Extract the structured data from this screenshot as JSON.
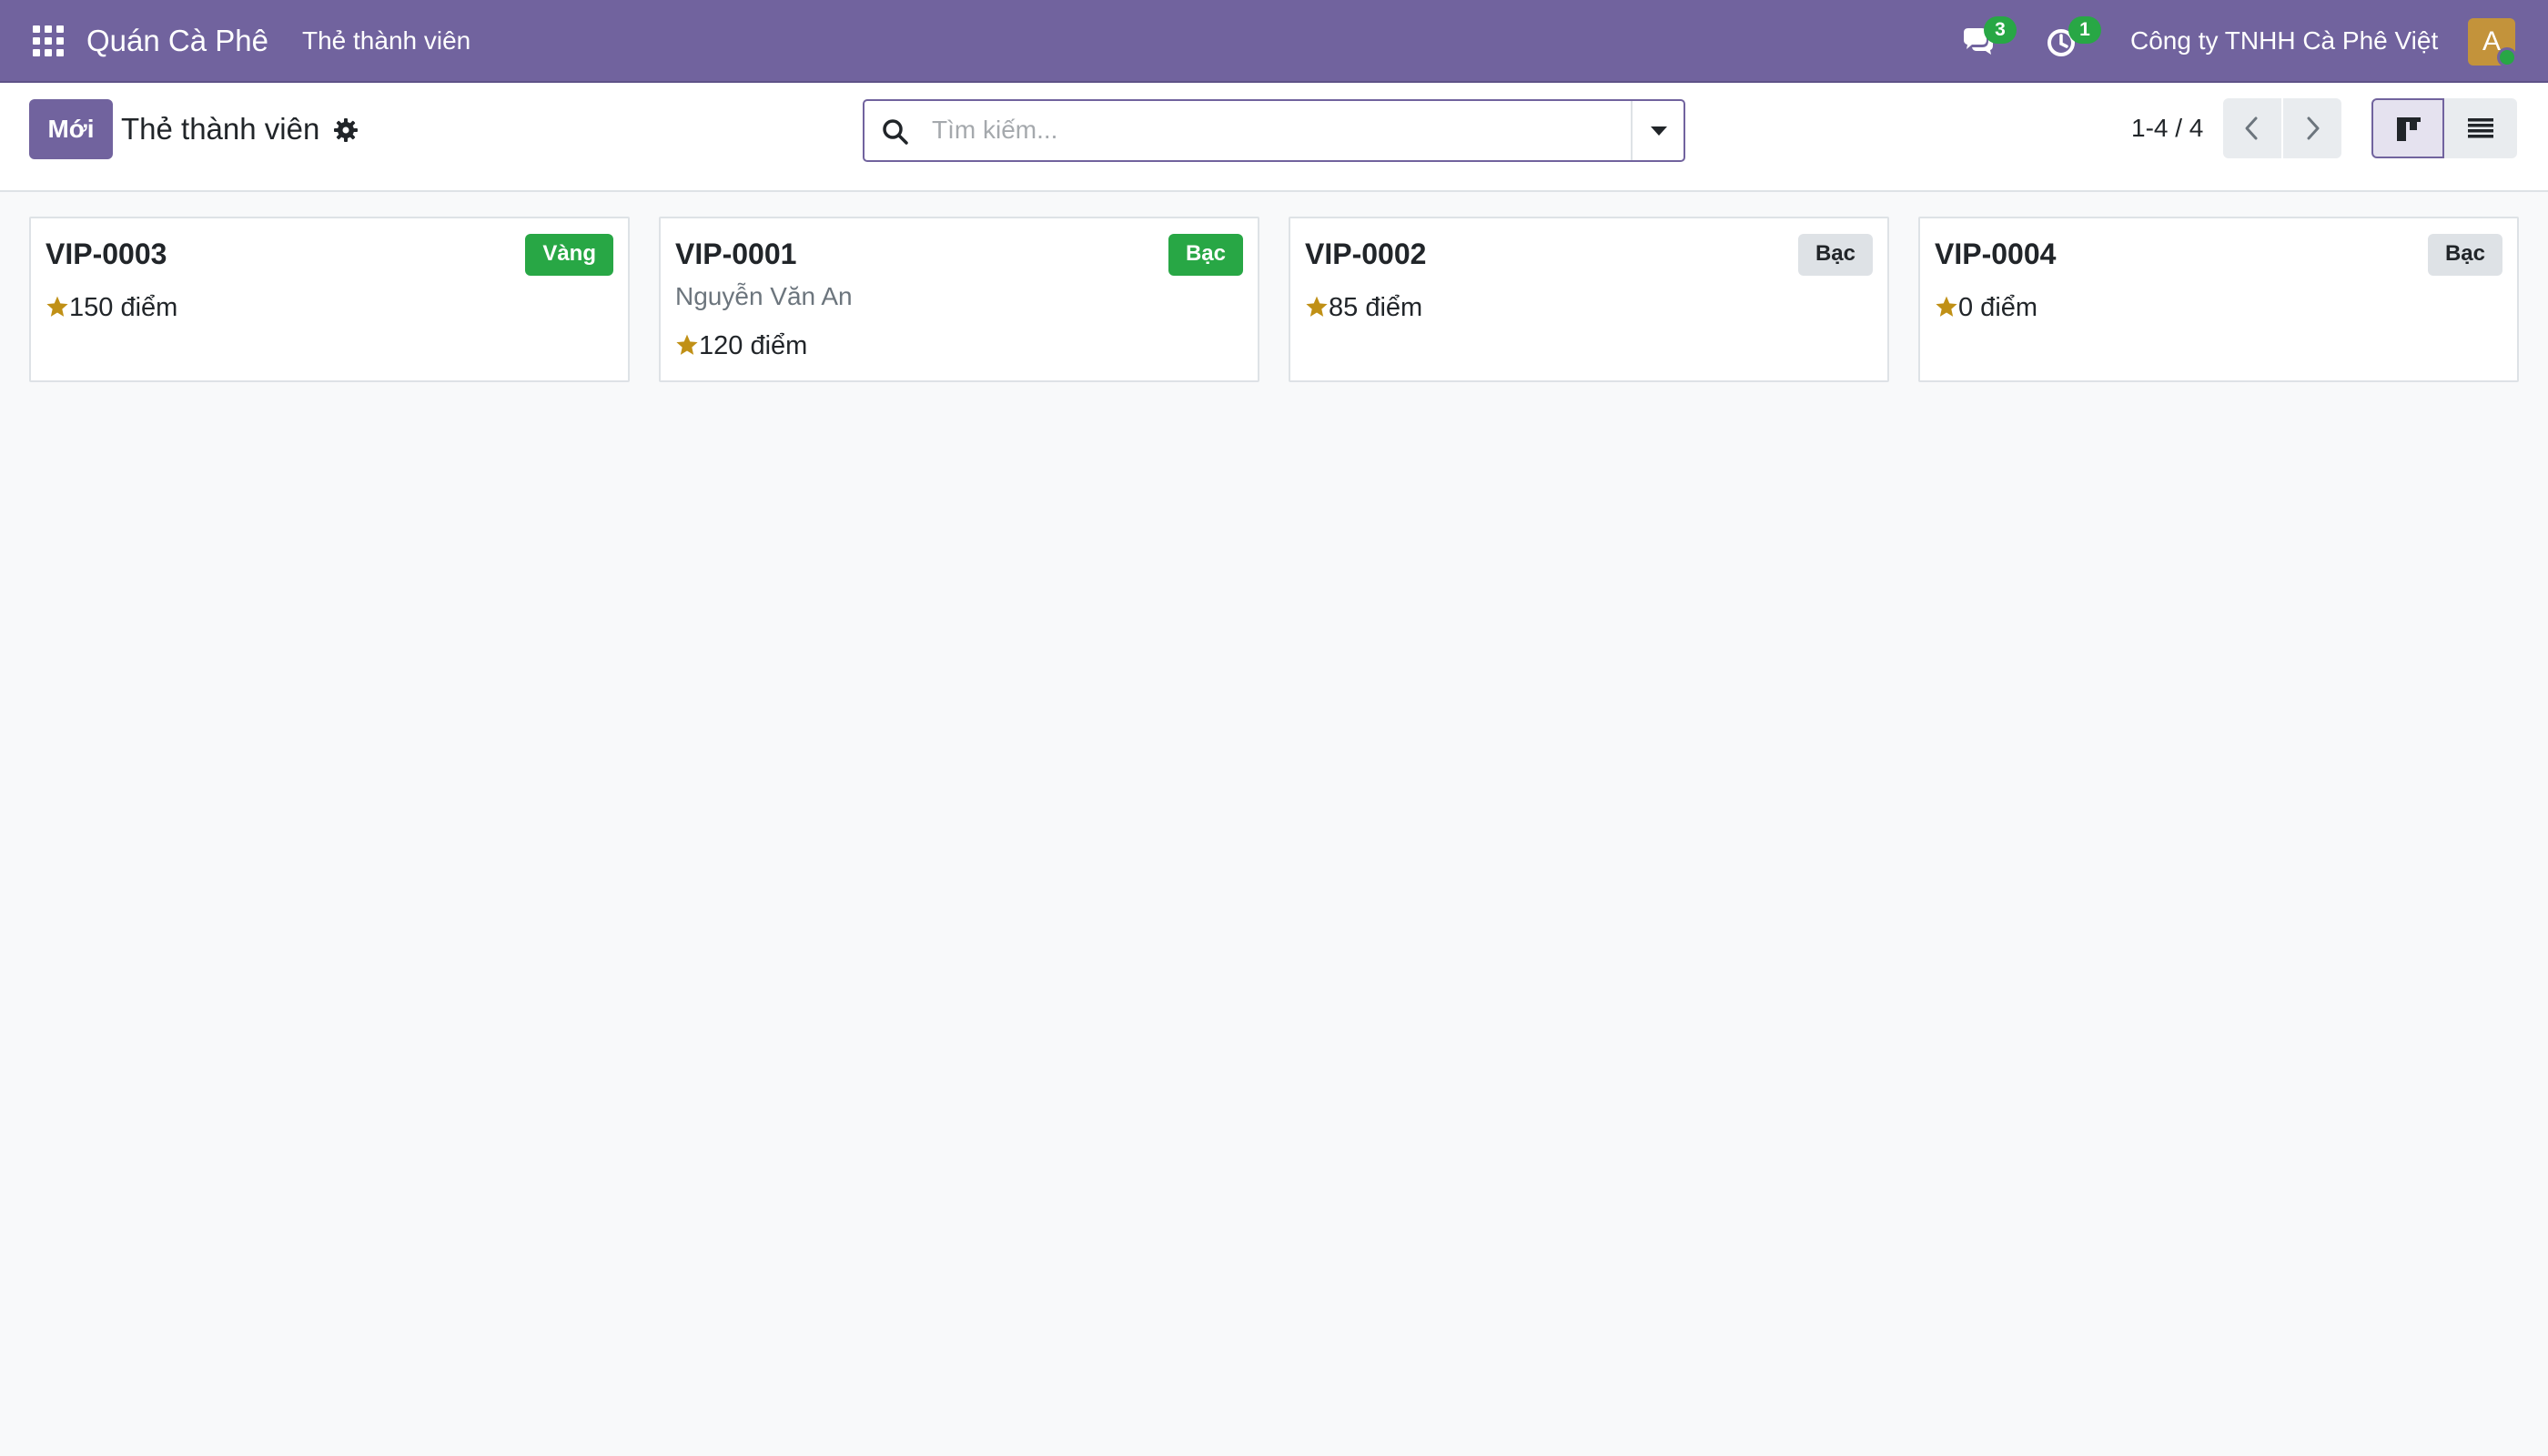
{
  "navbar": {
    "app_name": "Quán Cà Phê",
    "menu_item": "Thẻ thành viên",
    "chat_count": "3",
    "activity_count": "1",
    "company": "Công ty TNHH Cà Phê Việt",
    "avatar_initial": "A"
  },
  "control_panel": {
    "new_button": "Mới",
    "title": "Thẻ thành viên",
    "search_placeholder": "Tìm kiếm...",
    "pager": "1-4 / 4"
  },
  "cards": [
    {
      "code": "VIP-0003",
      "tier": "Vàng",
      "customer": "",
      "points": "150 điểm",
      "tier_color": "#28a745"
    },
    {
      "code": "VIP-0001",
      "tier": "Bạc",
      "customer": "Nguyễn Văn An",
      "points": "120 điểm",
      "tier_color": "#28a745"
    },
    {
      "code": "VIP-0002",
      "tier": "Bạc",
      "customer": "",
      "points": "85 điểm",
      "tier_color": "#dee2e6"
    },
    {
      "code": "VIP-0004",
      "tier": "Bạc",
      "customer": "",
      "points": "0 điểm",
      "tier_color": "#dee2e6"
    }
  ],
  "colors": {
    "brand": "#71639e",
    "badge": "#28a745",
    "star": "#c09016"
  },
  "icons": {
    "apps": "apps-grid-icon",
    "chat": "chat-bubbles-icon",
    "activity": "clock-icon",
    "gear": "gear-icon",
    "search": "search-icon",
    "star": "star-icon",
    "kanban": "kanban-view-icon",
    "list": "list-view-icon"
  }
}
